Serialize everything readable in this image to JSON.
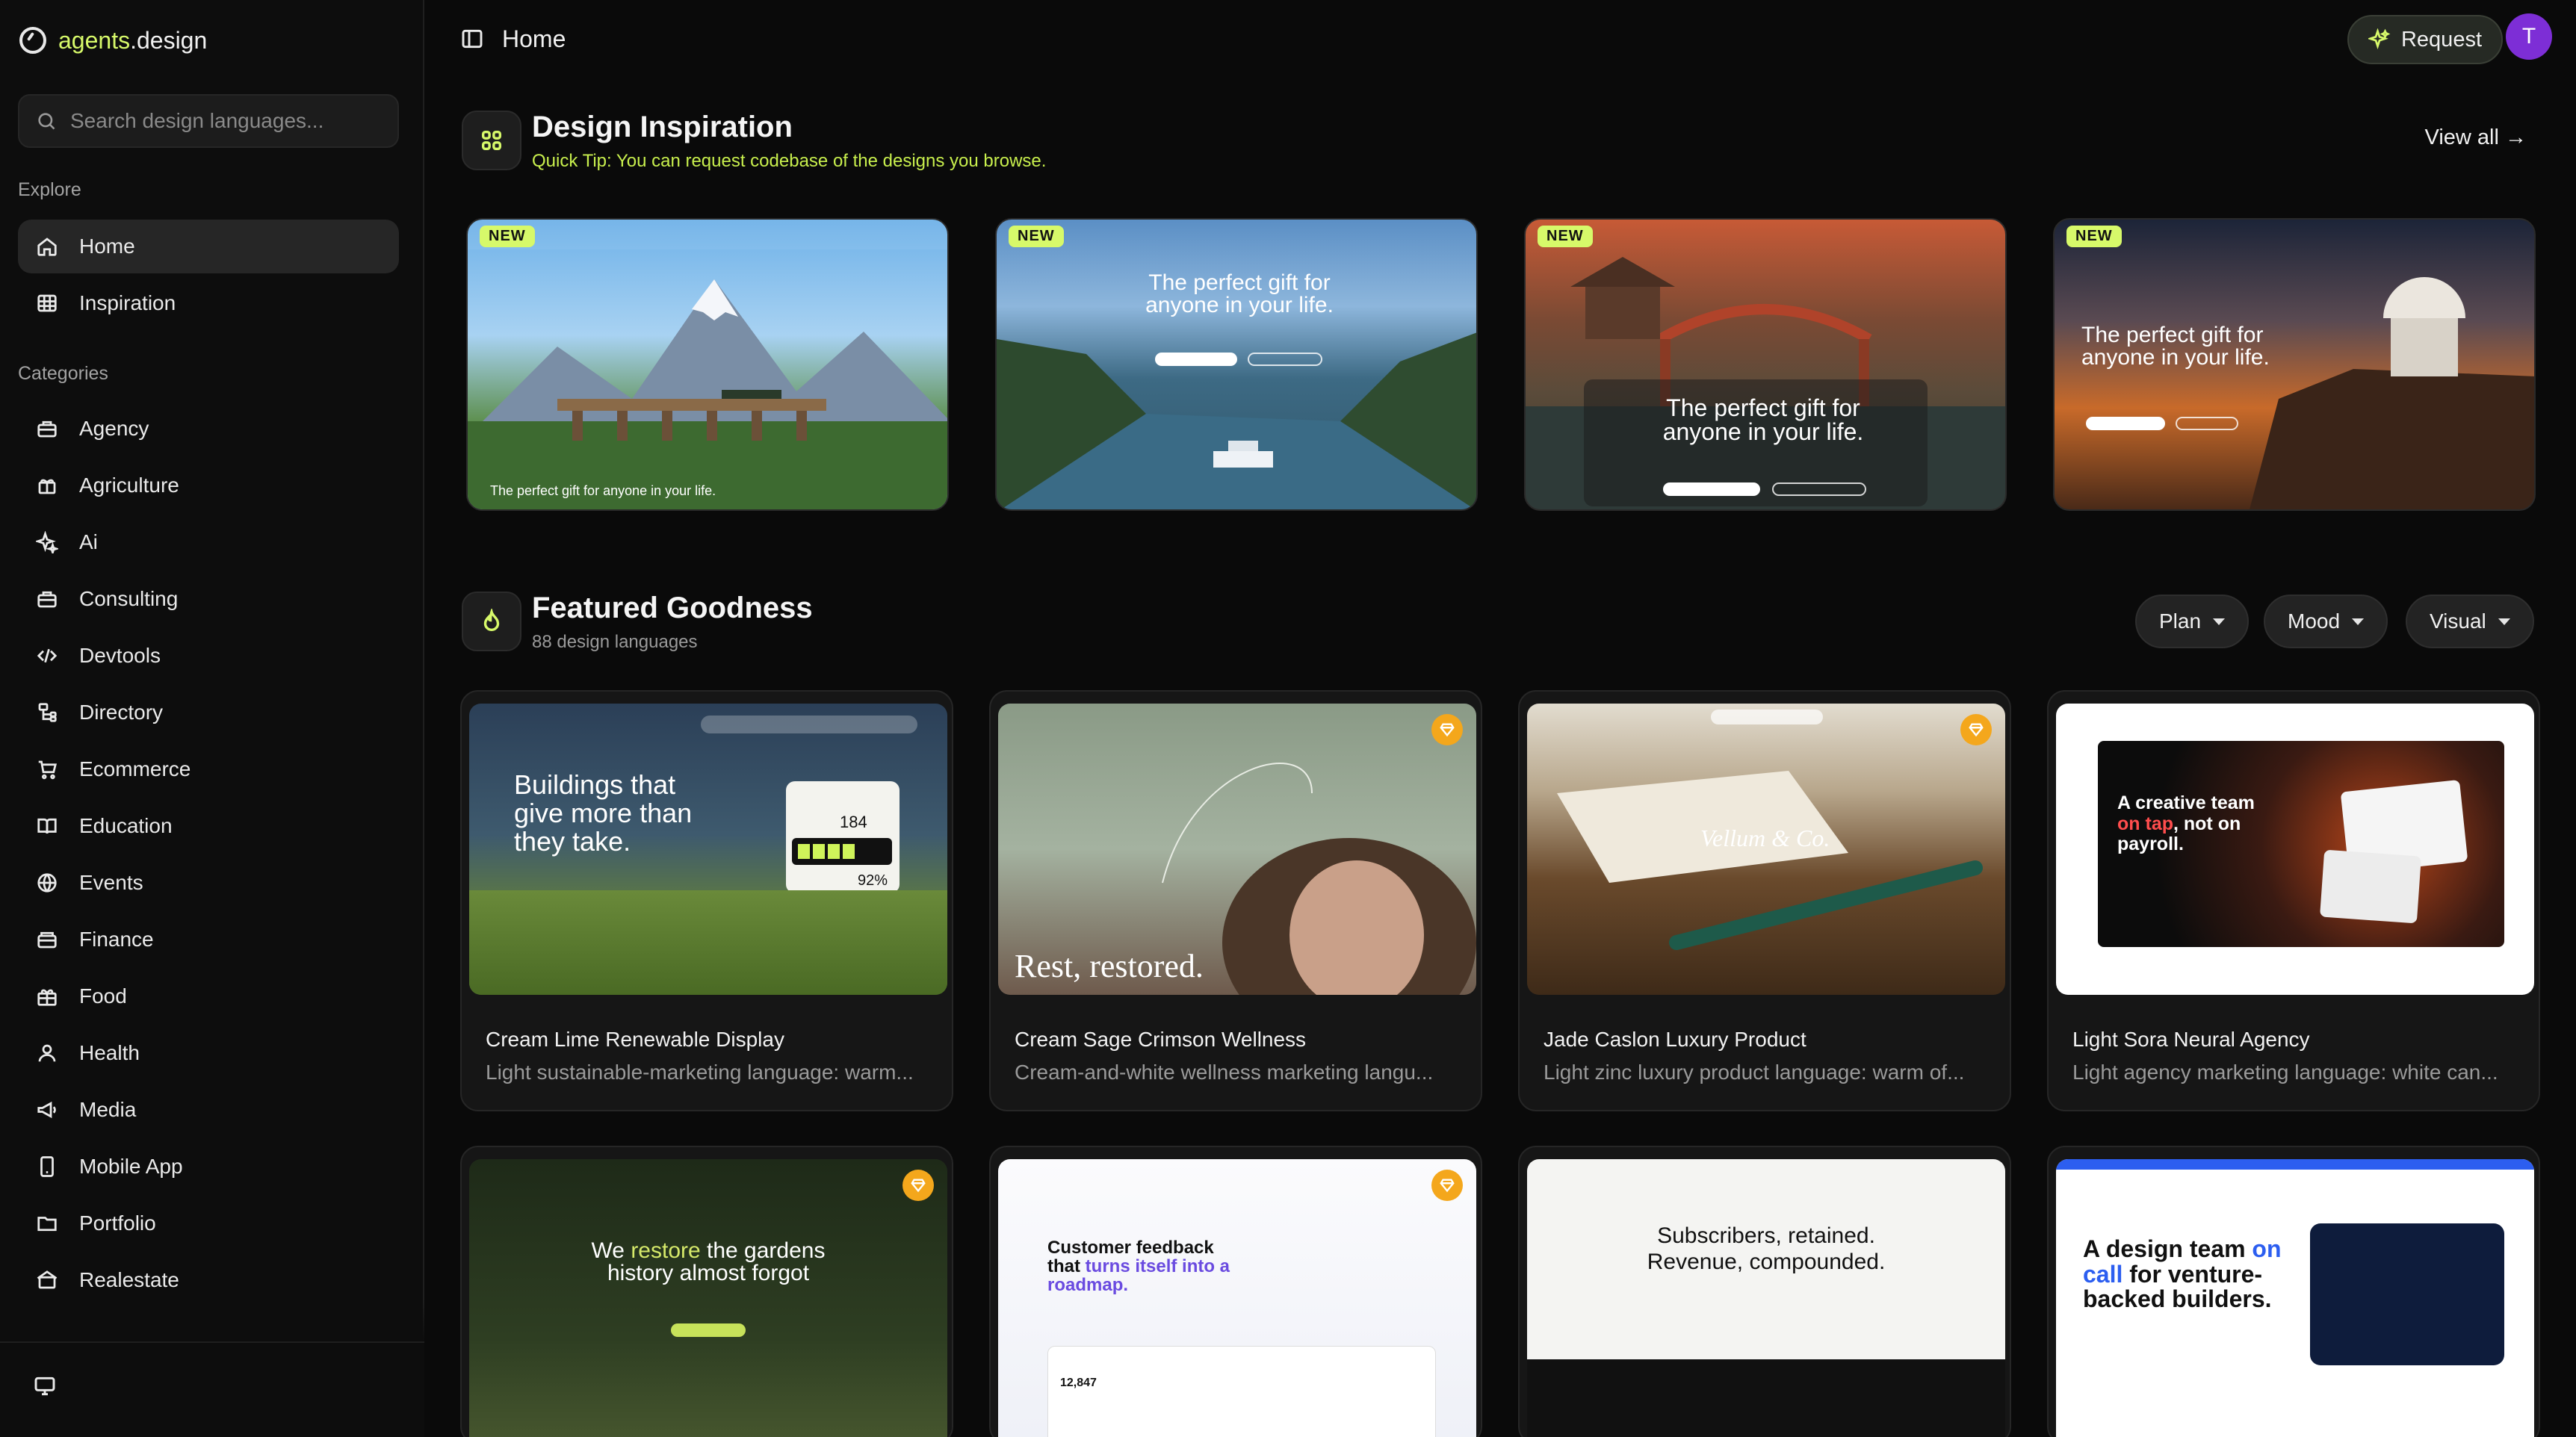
{
  "brand": {
    "name_prefix": "agents",
    "name_suffix": ".design"
  },
  "search": {
    "placeholder": "Search design languages..."
  },
  "sidebar": {
    "explore_label": "Explore",
    "explore": [
      {
        "label": "Home",
        "icon": "home-icon",
        "active": true
      },
      {
        "label": "Inspiration",
        "icon": "grid-icon"
      }
    ],
    "categories_label": "Categories",
    "categories": [
      {
        "label": "Agency",
        "icon": "briefcase-icon"
      },
      {
        "label": "Agriculture",
        "icon": "sprout-icon"
      },
      {
        "label": "Ai",
        "icon": "sparkle-icon"
      },
      {
        "label": "Consulting",
        "icon": "briefcase-icon"
      },
      {
        "label": "Devtools",
        "icon": "code-icon"
      },
      {
        "label": "Directory",
        "icon": "list-icon"
      },
      {
        "label": "Ecommerce",
        "icon": "cart-icon"
      },
      {
        "label": "Education",
        "icon": "book-icon"
      },
      {
        "label": "Events",
        "icon": "globe-icon"
      },
      {
        "label": "Finance",
        "icon": "wallet-icon"
      },
      {
        "label": "Food",
        "icon": "gift-icon"
      },
      {
        "label": "Health",
        "icon": "user-icon"
      },
      {
        "label": "Media",
        "icon": "megaphone-icon"
      },
      {
        "label": "Mobile App",
        "icon": "phone-icon"
      },
      {
        "label": "Portfolio",
        "icon": "folder-icon"
      },
      {
        "label": "Realestate",
        "icon": "home-icon"
      }
    ]
  },
  "header": {
    "title": "Home",
    "request_label": "Request",
    "avatar_initial": "T"
  },
  "inspiration": {
    "title": "Design Inspiration",
    "tip": "Quick Tip: You can request codebase of the designs you browse.",
    "view_all": "View all →",
    "badge": "NEW",
    "cards": [
      {
        "headline": "The perfect gift for anyone in your life."
      },
      {
        "headline": "The perfect gift for anyone in your life."
      },
      {
        "headline": "The perfect gift for anyone in your life."
      },
      {
        "headline": "The perfect gift for anyone in your life."
      }
    ]
  },
  "featured": {
    "title": "Featured Goodness",
    "count": "88 design languages",
    "filters": [
      "Plan",
      "Mood",
      "Visual"
    ],
    "cards": [
      {
        "name": "Cream Lime Renewable Display",
        "desc": "Light sustainable-marketing language: warm...",
        "hero": "Buildings that give more than they take.",
        "stat1": "184",
        "stat2": "92%"
      },
      {
        "name": "Cream Sage Crimson Wellness",
        "desc": "Cream-and-white wellness marketing langu...",
        "hero": "Rest,  restored."
      },
      {
        "name": "Jade Caslon Luxury Product",
        "desc": "Light zinc luxury product language: warm of...",
        "hero": "Vellum & Co."
      },
      {
        "name": "Light Sora Neural Agency",
        "desc": "Light agency marketing language: white can...",
        "hero_a": "A creative team ",
        "hero_b": "on tap",
        "hero_c": ", not on ",
        "hero_d": "payroll."
      }
    ],
    "row2": [
      {
        "hero_a": "We ",
        "hero_b": "restore",
        "hero_c": " the gardens history almost forgot"
      },
      {
        "hero_a": "Customer feedback that ",
        "hero_b": "turns itself into a roadmap.",
        "stat": "12,847"
      },
      {
        "hero": "Subscribers, retained. Revenue, compounded."
      },
      {
        "hero_a": "A design team ",
        "hero_b": "on call",
        "hero_c": " for venture-backed builders."
      }
    ]
  }
}
